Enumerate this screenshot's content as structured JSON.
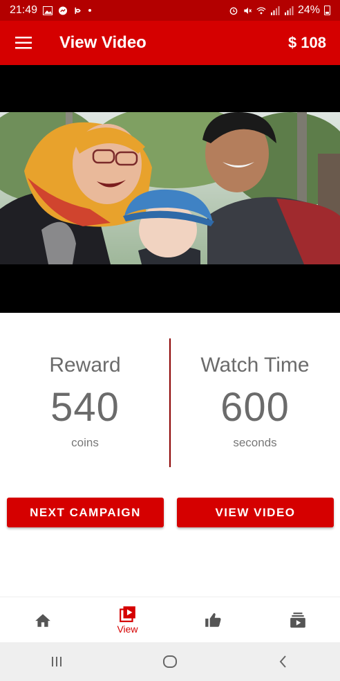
{
  "status_bar": {
    "time": "21:49",
    "battery": "24%",
    "icons": [
      "image-icon",
      "messenger-icon",
      "app-icon",
      "alarm-icon",
      "mute-icon",
      "wifi-icon",
      "signal-icon",
      "battery-icon"
    ]
  },
  "app_bar": {
    "title": "View Video",
    "balance": "$ 108",
    "menu_icon": "hamburger-menu-icon"
  },
  "video": {
    "thumbnail": "family-selfie-video-thumbnail"
  },
  "stats": {
    "reward": {
      "label": "Reward",
      "value": "540",
      "unit": "coins"
    },
    "watch_time": {
      "label": "Watch Time",
      "value": "600",
      "unit": "seconds"
    }
  },
  "actions": {
    "next_campaign": "NEXT CAMPAIGN",
    "view_video": "VIEW VIDEO"
  },
  "bottom_nav": {
    "items": [
      {
        "icon": "home-icon",
        "label": ""
      },
      {
        "icon": "play-video-icon",
        "label": "View",
        "active": true
      },
      {
        "icon": "thumbs-up-icon",
        "label": ""
      },
      {
        "icon": "subscriptions-icon",
        "label": ""
      }
    ]
  },
  "colors": {
    "primary": "#d50000",
    "status_bar": "#b30000",
    "text_gray": "#6b6b6b",
    "divider": "#8b0000"
  }
}
